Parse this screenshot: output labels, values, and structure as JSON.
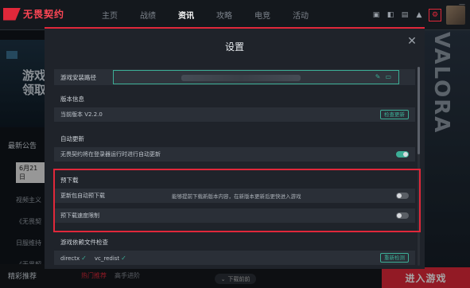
{
  "app": {
    "logo_text": "无畏契约"
  },
  "nav": {
    "items": [
      "主页",
      "战绩",
      "资讯",
      "攻略",
      "电竞",
      "活动"
    ],
    "active_index": 2
  },
  "window": {
    "settings_icon": "gear-icon",
    "notification_icon": "bell-icon"
  },
  "background": {
    "banner_text": "游戏\n领取",
    "valorant_text": "VALORA",
    "news_title": "最新公告",
    "news_items": [
      "6月21日",
      "视频主义",
      "《无畏契",
      "日服维持",
      "《无畏契"
    ],
    "bottom_title": "精彩推荐",
    "bottom_tabs": [
      "热门推荐",
      "高手进阶"
    ],
    "download_label": "下载前前",
    "enter_game": "进入游戏"
  },
  "settings": {
    "title": "设置",
    "install_path": {
      "label": "游戏安装路径",
      "value": ""
    },
    "version": {
      "label": "版本信息",
      "value": "当前版本 V2.2.0",
      "button": "检查更新"
    },
    "auto_update": {
      "label": "自动更新",
      "text": "无畏契约将在登录器运行时进行自动更新",
      "enabled": true
    },
    "predownload": {
      "label": "预下载",
      "auto": {
        "text": "更新包自动预下载",
        "hint": "能够提前下载新版本内容，在新版本更新后更快进入游戏",
        "enabled": false
      },
      "limit": {
        "text": "预下载速度限制",
        "enabled": false
      }
    },
    "dependencies": {
      "label": "游戏依赖文件检查",
      "items": [
        "directx",
        "vc_redist"
      ],
      "button": "重新检测"
    }
  },
  "colors": {
    "accent": "#e0283a",
    "teal": "#3cae96",
    "panel": "#1f232a",
    "row": "#2a2f37"
  }
}
